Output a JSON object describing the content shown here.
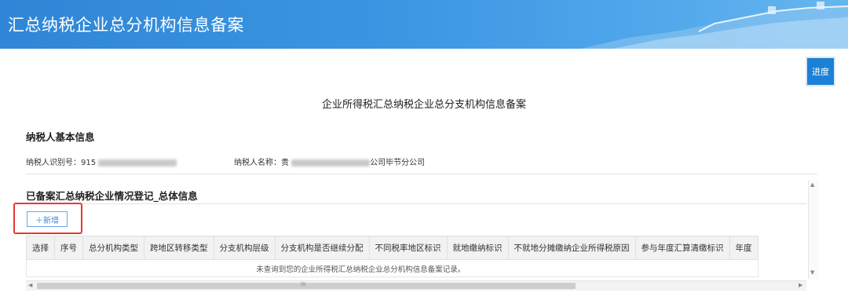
{
  "header": {
    "title": "汇总纳税企业总分机构信息备案"
  },
  "progress_button": {
    "label": "进度"
  },
  "page_title": "企业所得税汇总纳税企业总分支机构信息备案",
  "basic_info": {
    "title": "纳税人基本信息",
    "taxpayer_id_label": "纳税人识别号：",
    "taxpayer_id_visible": "915",
    "taxpayer_name_label": "纳税人名称：",
    "taxpayer_name_prefix": "贵",
    "taxpayer_name_suffix": "公司毕节分公司"
  },
  "registered_section": {
    "title": "已备案汇总纳税企业情况登记_总体信息",
    "add_button": "＋新增"
  },
  "table": {
    "headers": [
      "选择",
      "序号",
      "总分机构类型",
      "跨地区转移类型",
      "分支机构层级",
      "分支机构是否继续分配",
      "不同税率地区标识",
      "就地缴纳标识",
      "不就地分摊缴纳企业所得税原因",
      "参与年度汇算清缴标识",
      "年度"
    ],
    "empty_message": "未查询到您的企业所得税汇总纳税企业总分机构信息备案记录。"
  },
  "scrollbar": {
    "thumb_grip": "III"
  },
  "colors": {
    "banner": "#2f86d6",
    "accent": "#1d80d7",
    "highlight_box": "#e53935"
  }
}
